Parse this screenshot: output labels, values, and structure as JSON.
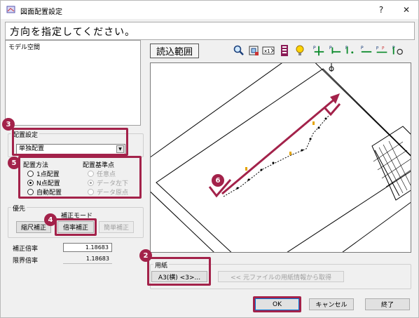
{
  "window": {
    "title": "図面配置設定",
    "help_label": "?",
    "close_label": "✕"
  },
  "header": {
    "instruction": "方向を指定してください。"
  },
  "space_list": {
    "items": [
      "モデル空間"
    ]
  },
  "placement_settings": {
    "label": "配置設定",
    "selected": "単独配置"
  },
  "placement_method": {
    "label": "配置方法",
    "options": [
      "1点配置",
      "N点配置",
      "自動配置"
    ],
    "selected_index": 1
  },
  "placement_base": {
    "label": "配置基準点",
    "options": [
      "任意点",
      "データ左下",
      "データ原点"
    ],
    "selected_index": 1
  },
  "priority": {
    "label": "優先",
    "mode_label": "補正モード",
    "buttons": [
      "縮尺補正",
      "倍率補正",
      "簡単補正"
    ],
    "correction_ratio_label": "補正倍率",
    "correction_ratio_value": "1.18683",
    "limit_ratio_label": "限界倍率",
    "limit_ratio_value": "1.18683"
  },
  "toolbar": {
    "read_range_label": "読込範囲",
    "icons": [
      "zoom-icon",
      "fit-window-icon",
      "scale-icon",
      "layer-icon",
      "bulb-icon",
      "point-add-icon",
      "point-line-icon",
      "point-dot-icon",
      "point-dash-icon",
      "point-double-icon",
      "point-rotate-icon"
    ]
  },
  "paper": {
    "label": "用紙",
    "size_button": "A3(横) <3>...",
    "from_file_button": "<< 元ファイルの用紙情報から取得"
  },
  "footer": {
    "ok_label": "OK",
    "cancel_label": "キャンセル",
    "finish_label": "終了"
  },
  "badges": [
    "2",
    "3",
    "4",
    "5",
    "6"
  ],
  "colors": {
    "accent": "#a3224a"
  }
}
